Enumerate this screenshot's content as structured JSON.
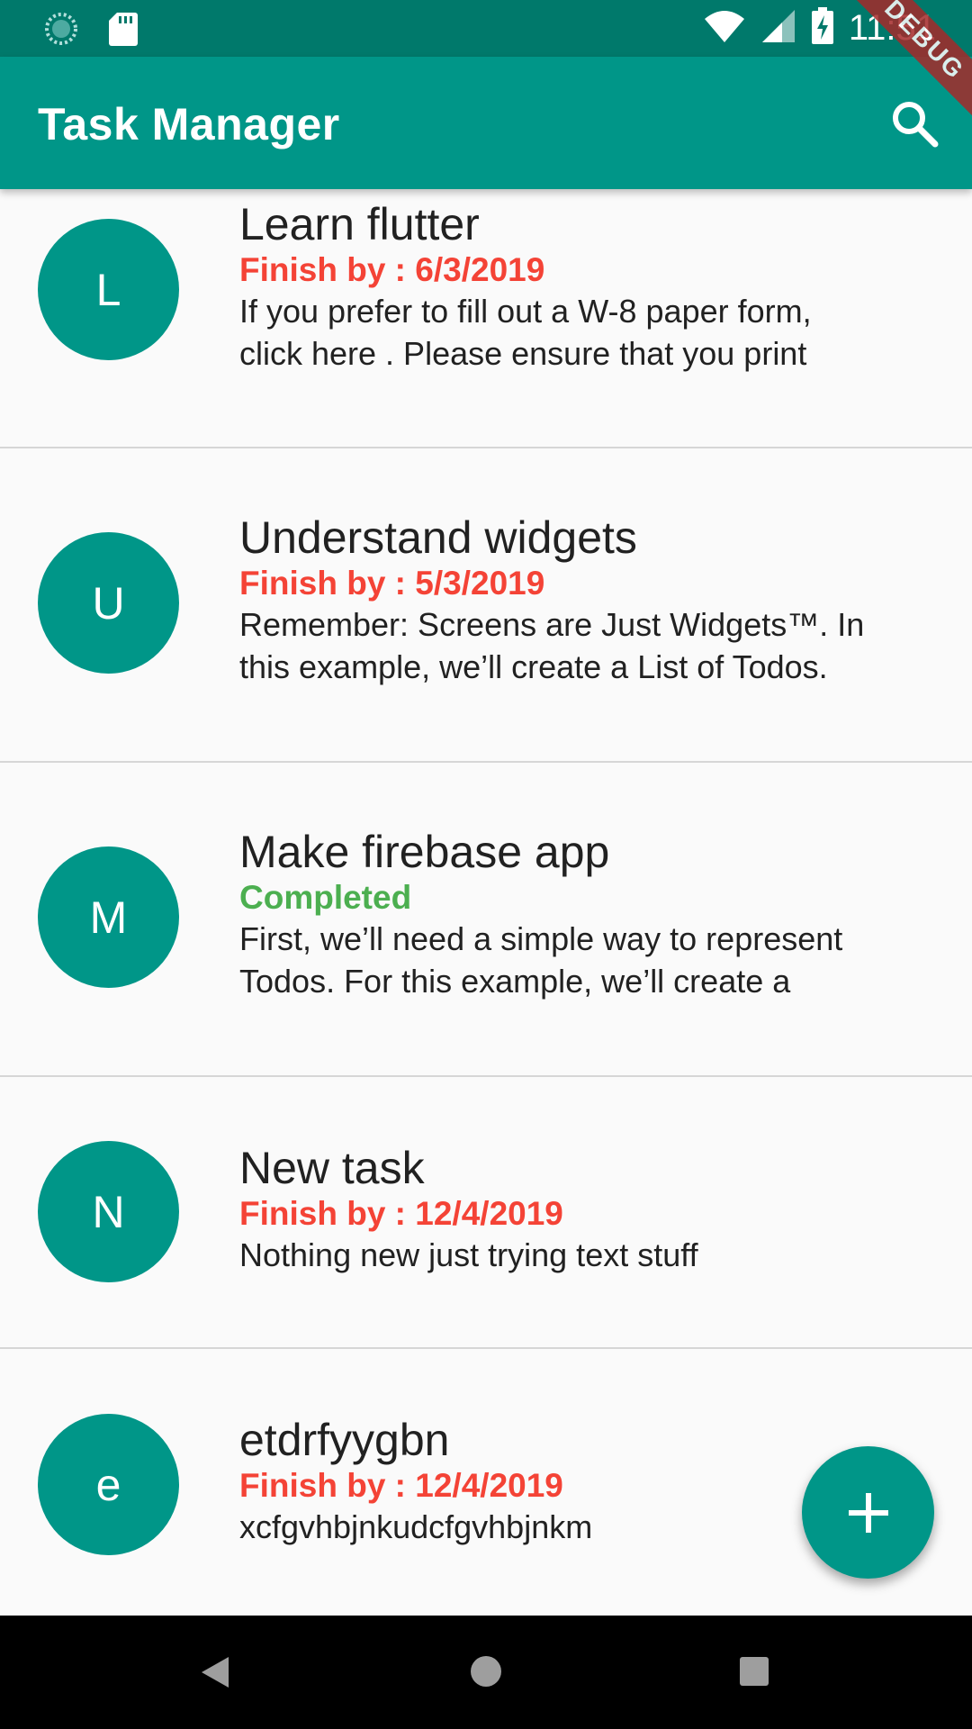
{
  "status_bar": {
    "time": "11:51",
    "icons": [
      "loading-icon",
      "sd-card-icon",
      "wifi-icon",
      "signal-icon",
      "battery-charging-icon"
    ]
  },
  "app_bar": {
    "title": "Task Manager",
    "search_icon": "search-icon"
  },
  "debug_banner": "DEBUG",
  "colors": {
    "primary": "#009688",
    "primary_dark": "#00796b",
    "due": "#f44336",
    "completed": "#4caf50"
  },
  "tasks": [
    {
      "initial": "L",
      "title": "Learn flutter",
      "status": "Finish by : 6/3/2019",
      "desc_line1": "If you prefer to fill out a W-8 paper form,",
      "desc_line2": "click  here . Please ensure that you print"
    },
    {
      "initial": "U",
      "title": "Understand widgets",
      "status": "Finish by : 5/3/2019",
      "desc_line1": "Remember: Screens are Just Widgets™. In",
      "desc_line2": "this example, we’ll create a List of Todos."
    },
    {
      "initial": "M",
      "title": "Make firebase app",
      "status": "Completed",
      "desc_line1": "First, we’ll need a simple way to represent",
      "desc_line2": "Todos. For this example, we’ll create a"
    },
    {
      "initial": "N",
      "title": "New task",
      "status": "Finish by : 12/4/2019",
      "desc_line1": "Nothing new just trying text stuff"
    },
    {
      "initial": "e",
      "title": "etdrfyygbn",
      "status": "Finish by : 12/4/2019",
      "desc_line1": "xcfgvhbjnkudcfgvhbjnkm"
    }
  ],
  "fab": {
    "icon": "add-icon"
  },
  "nav_bar": {
    "icons": [
      "back-icon",
      "home-icon",
      "recents-icon"
    ]
  }
}
